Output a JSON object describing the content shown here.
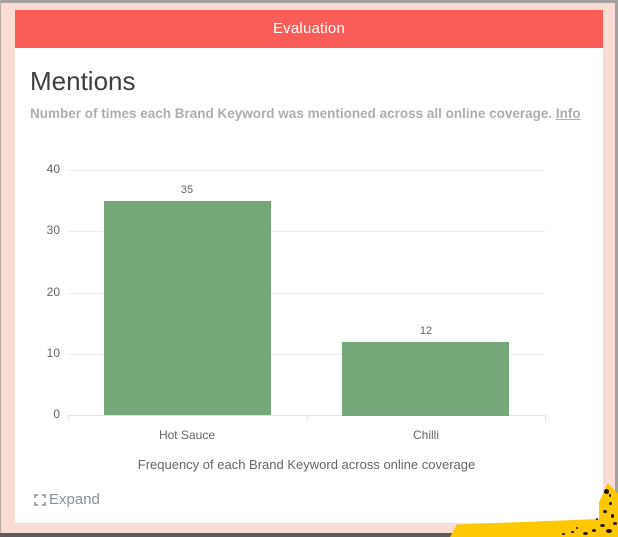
{
  "window": {
    "header_title": "Evaluation"
  },
  "panel": {
    "title": "Mentions",
    "subtitle": "Number of times each Brand Keyword was mentioned across all online coverage.",
    "info_link": "Info",
    "expand_label": "Expand"
  },
  "chart_data": {
    "type": "bar",
    "title": "Mentions",
    "categories": [
      "Hot Sauce",
      "Chilli"
    ],
    "values": [
      35,
      12
    ],
    "xlabel": "Frequency of each Brand Keyword across online coverage",
    "ylabel": "",
    "ylim": [
      0,
      40
    ],
    "yticks": [
      0,
      10,
      20,
      30,
      40
    ],
    "grid": true,
    "legend": false,
    "value_labels": true
  },
  "colors": {
    "header_bg": "#fa5c57",
    "header_text": "#ffffff",
    "frame_pink": "#f9dcd3",
    "bar_green": "#76a97a",
    "accent_yellow": "#fdc702"
  }
}
